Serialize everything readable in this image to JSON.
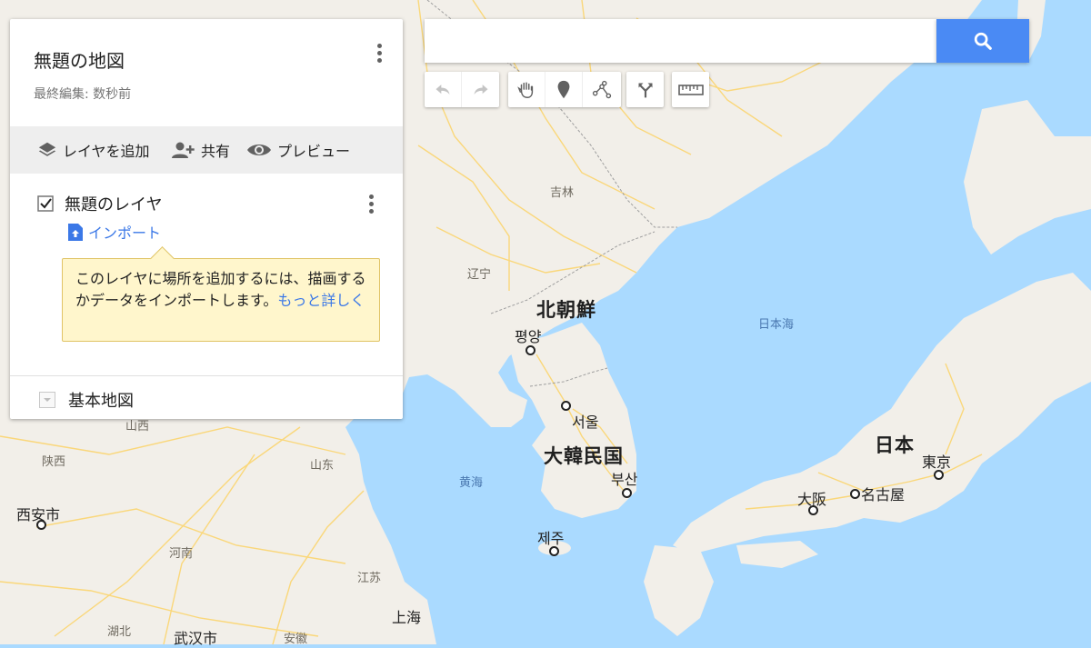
{
  "panel": {
    "title": "無題の地図",
    "last_edited": "最終編集: 数秒前",
    "actions": {
      "add_layer": "レイヤを追加",
      "share": "共有",
      "preview": "プレビュー"
    },
    "layer": {
      "name": "無題のレイヤ",
      "checked": true,
      "import_label": "インポート"
    },
    "tip": {
      "text": "このレイヤに場所を追加するには、描画するかデータをインポートします。",
      "more_link": "もっと詳しく"
    },
    "basemap_label": "基本地図"
  },
  "search": {
    "placeholder": "",
    "value": ""
  },
  "toolbar": {
    "icons": [
      "undo-icon",
      "redo-icon",
      "hand-icon",
      "marker-icon",
      "line-icon",
      "directions-icon",
      "ruler-icon"
    ]
  },
  "map": {
    "labels": {
      "jilin": "吉林",
      "liaoning": "辽宁",
      "north_korea": "北朝鮮",
      "pyongyang": "평양",
      "seoul": "서울",
      "south_korea": "大韓民国",
      "busan": "부산",
      "jeju": "제주",
      "sea_of_japan": "日本海",
      "yellow_sea": "黄海",
      "japan": "日本",
      "tokyo": "東京",
      "osaka": "大阪",
      "nagoya": "名古屋",
      "shanxi1": "山西",
      "shaanxi": "陕西",
      "shandong": "山东",
      "xian": "西安市",
      "henan": "河南",
      "jiangsu": "江苏",
      "shanghai": "上海",
      "hubei": "湖北",
      "wuhan": "武汉市",
      "anhui": "安徽"
    },
    "colors": {
      "water": "#aadaff",
      "land": "#f2efe9",
      "road": "#fde293",
      "accent": "#4a8af4",
      "link": "#3b78e7"
    }
  }
}
